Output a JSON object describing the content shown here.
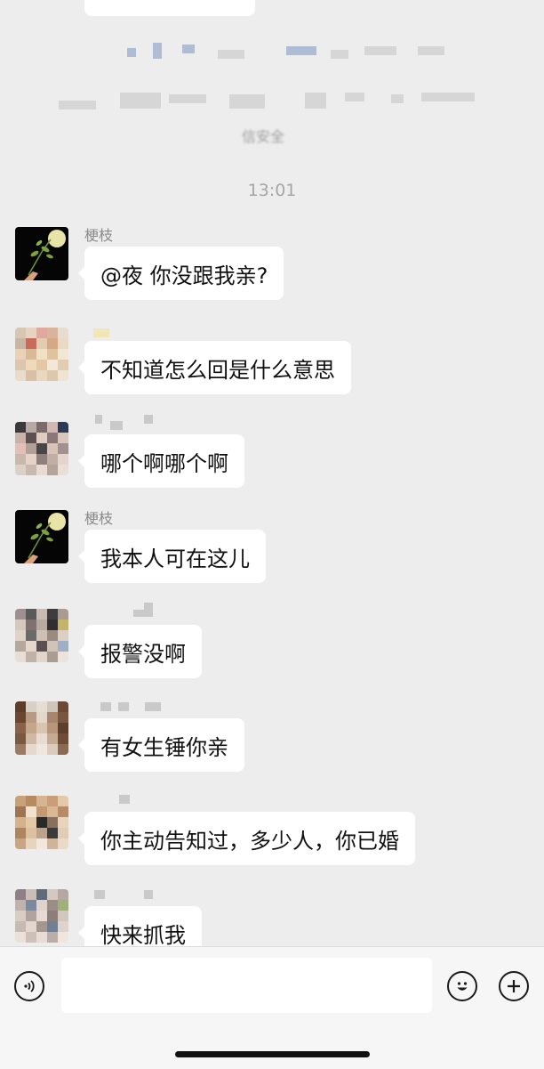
{
  "timestamp": "13:01",
  "system_notice_tail": "信安全",
  "messages": [
    {
      "sender": "梗枝",
      "text": "@夜 你没跟我亲?"
    },
    {
      "sender": "",
      "text": "不知道怎么回是什么意思"
    },
    {
      "sender": "",
      "text": "哪个啊哪个啊"
    },
    {
      "sender": "梗枝",
      "text": "我本人可在这儿"
    },
    {
      "sender": "",
      "text": "报警没啊"
    },
    {
      "sender": "",
      "text": "有女生锤你亲"
    },
    {
      "sender": "",
      "text": "你主动告知过，多少人，你已婚"
    },
    {
      "sender": "",
      "text": "快来抓我"
    }
  ],
  "input_bar": {
    "voice_icon": "voice-icon",
    "emoji_icon": "emoji-icon",
    "plus_icon": "plus-icon",
    "text_value": ""
  },
  "colors": {
    "background": "#ededed",
    "bubble": "#ffffff",
    "input_bar": "#f6f6f6"
  }
}
